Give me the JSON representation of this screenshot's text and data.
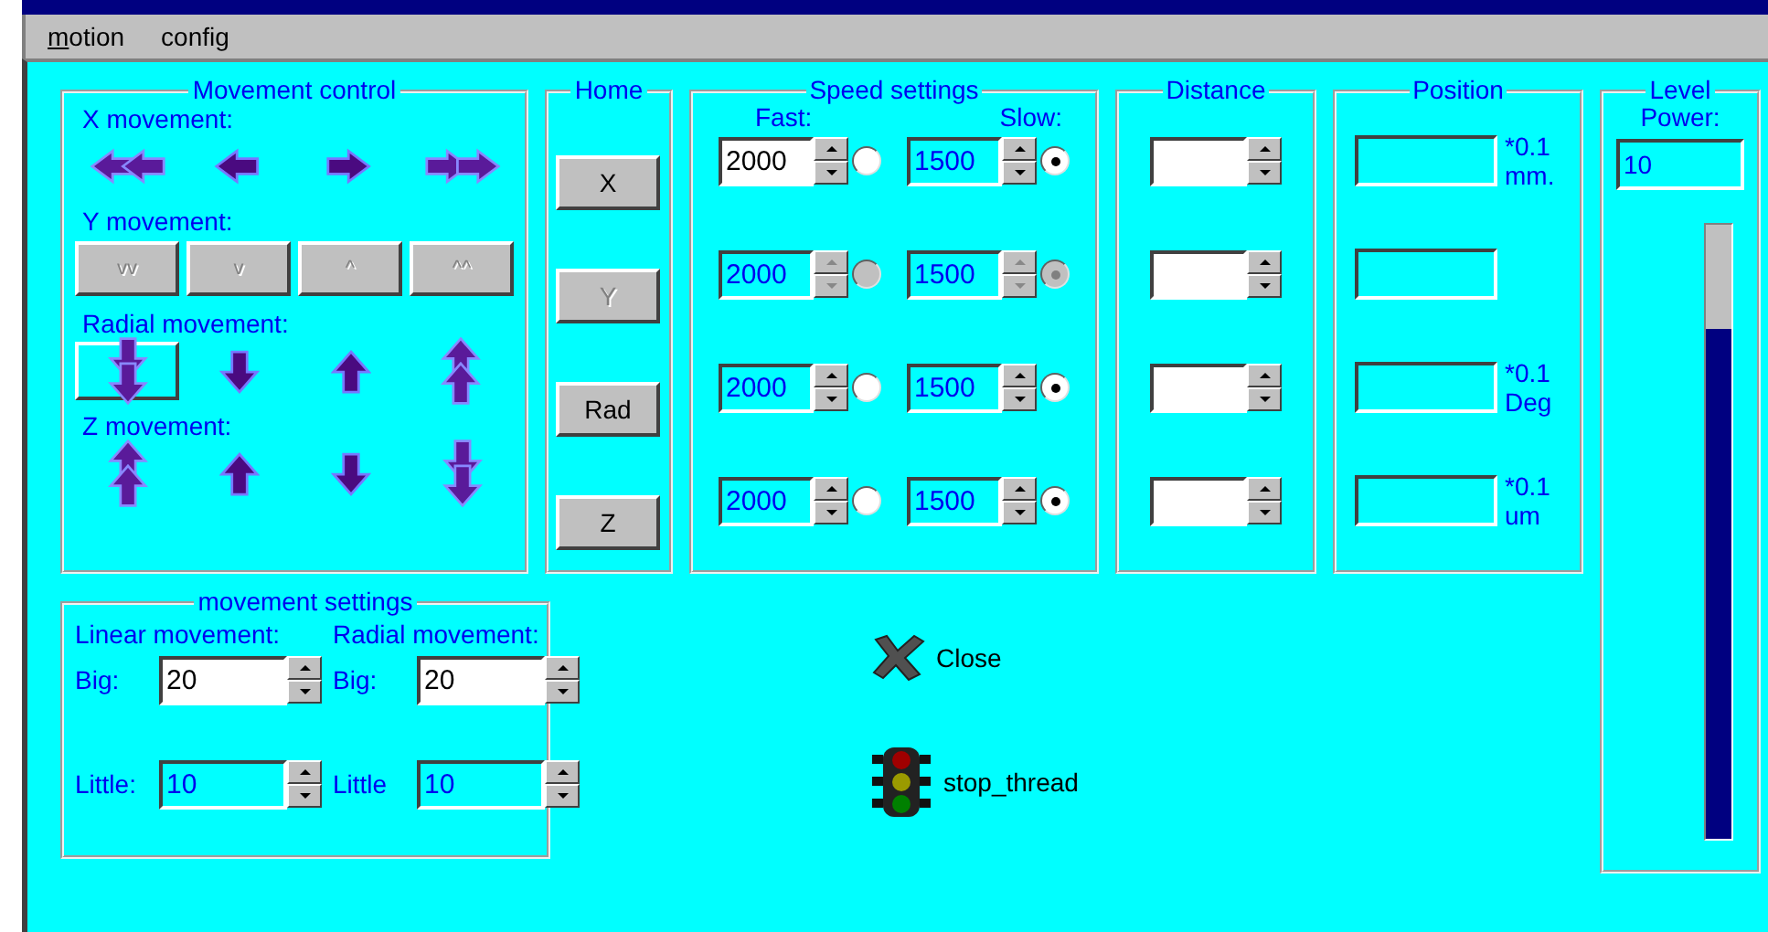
{
  "menu": [
    {
      "label": "motion",
      "mnemonic_underlined": true
    },
    {
      "label": "config",
      "mnemonic_underlined": false
    }
  ],
  "movement_control": {
    "title": "Movement control",
    "sections": [
      {
        "label": "X movement:",
        "kind": "horizontal",
        "buttons": [
          {
            "framed": false
          },
          {
            "framed": false
          },
          {
            "framed": false
          },
          {
            "framed": false
          }
        ]
      },
      {
        "label": "Y movement:",
        "kind": "text",
        "buttons": [
          {
            "label": "vv",
            "disabled": true
          },
          {
            "label": "v",
            "disabled": true
          },
          {
            "label": "^",
            "disabled": true
          },
          {
            "label": "^^",
            "disabled": true
          }
        ]
      },
      {
        "label": "Radial movement:",
        "kind": "radial",
        "buttons": [
          {
            "framed": true
          },
          {
            "framed": false
          },
          {
            "framed": false
          },
          {
            "framed": false
          }
        ]
      },
      {
        "label": "Z movement:",
        "kind": "vertical",
        "buttons": [
          {
            "framed": false
          },
          {
            "framed": false
          },
          {
            "framed": false
          },
          {
            "framed": false
          }
        ]
      }
    ]
  },
  "home": {
    "title": "Home",
    "buttons": [
      {
        "label": "X",
        "disabled": false
      },
      {
        "label": "Y",
        "disabled": true
      },
      {
        "label": "Rad",
        "disabled": false
      },
      {
        "label": "Z",
        "disabled": false
      }
    ]
  },
  "speed_settings": {
    "title": "Speed settings",
    "fast_label": "Fast:",
    "slow_label": "Slow:",
    "rows": [
      {
        "fast": {
          "value": "2000",
          "active": true,
          "disabled": false,
          "selected": false
        },
        "slow": {
          "value": "1500",
          "active": false,
          "disabled": false,
          "selected": true
        }
      },
      {
        "fast": {
          "value": "2000",
          "active": false,
          "disabled": true,
          "selected": false
        },
        "slow": {
          "value": "1500",
          "active": false,
          "disabled": true,
          "selected": true
        }
      },
      {
        "fast": {
          "value": "2000",
          "active": false,
          "disabled": false,
          "selected": false
        },
        "slow": {
          "value": "1500",
          "active": false,
          "disabled": false,
          "selected": true
        }
      },
      {
        "fast": {
          "value": "2000",
          "active": false,
          "disabled": false,
          "selected": false
        },
        "slow": {
          "value": "1500",
          "active": false,
          "disabled": false,
          "selected": true
        }
      }
    ]
  },
  "distance": {
    "title": "Distance",
    "fields": [
      {
        "active": true
      },
      {
        "active": true
      },
      {
        "active": true
      },
      {
        "active": true
      }
    ]
  },
  "position": {
    "title": "Position",
    "rows": [
      {
        "kind": "unit",
        "unit": [
          "*0.1",
          "mm."
        ]
      },
      {
        "kind": "plain"
      },
      {
        "kind": "unit",
        "unit": [
          "*0.1",
          "Deg"
        ]
      },
      {
        "kind": "unit",
        "unit": [
          "*0.1",
          "um"
        ]
      }
    ]
  },
  "level": {
    "title": "Level",
    "power_label": "Power:",
    "power_value": "10",
    "level": 0.83
  },
  "movement_settings": {
    "title": "movement settings",
    "columns": [
      {
        "heading": "Linear movement:",
        "rows": [
          {
            "label": "Big:",
            "value": "20",
            "active": true
          },
          {
            "label": "Little:",
            "value": "10",
            "active": false
          }
        ]
      },
      {
        "heading": "Radial movement:",
        "rows": [
          {
            "label": "Big:",
            "value": "20",
            "active": true
          },
          {
            "label": "Little",
            "value": "10",
            "active": false
          }
        ]
      }
    ]
  },
  "actions": [
    {
      "kind": "close",
      "label": "Close"
    },
    {
      "kind": "traffic-light",
      "label": "stop_thread"
    }
  ]
}
